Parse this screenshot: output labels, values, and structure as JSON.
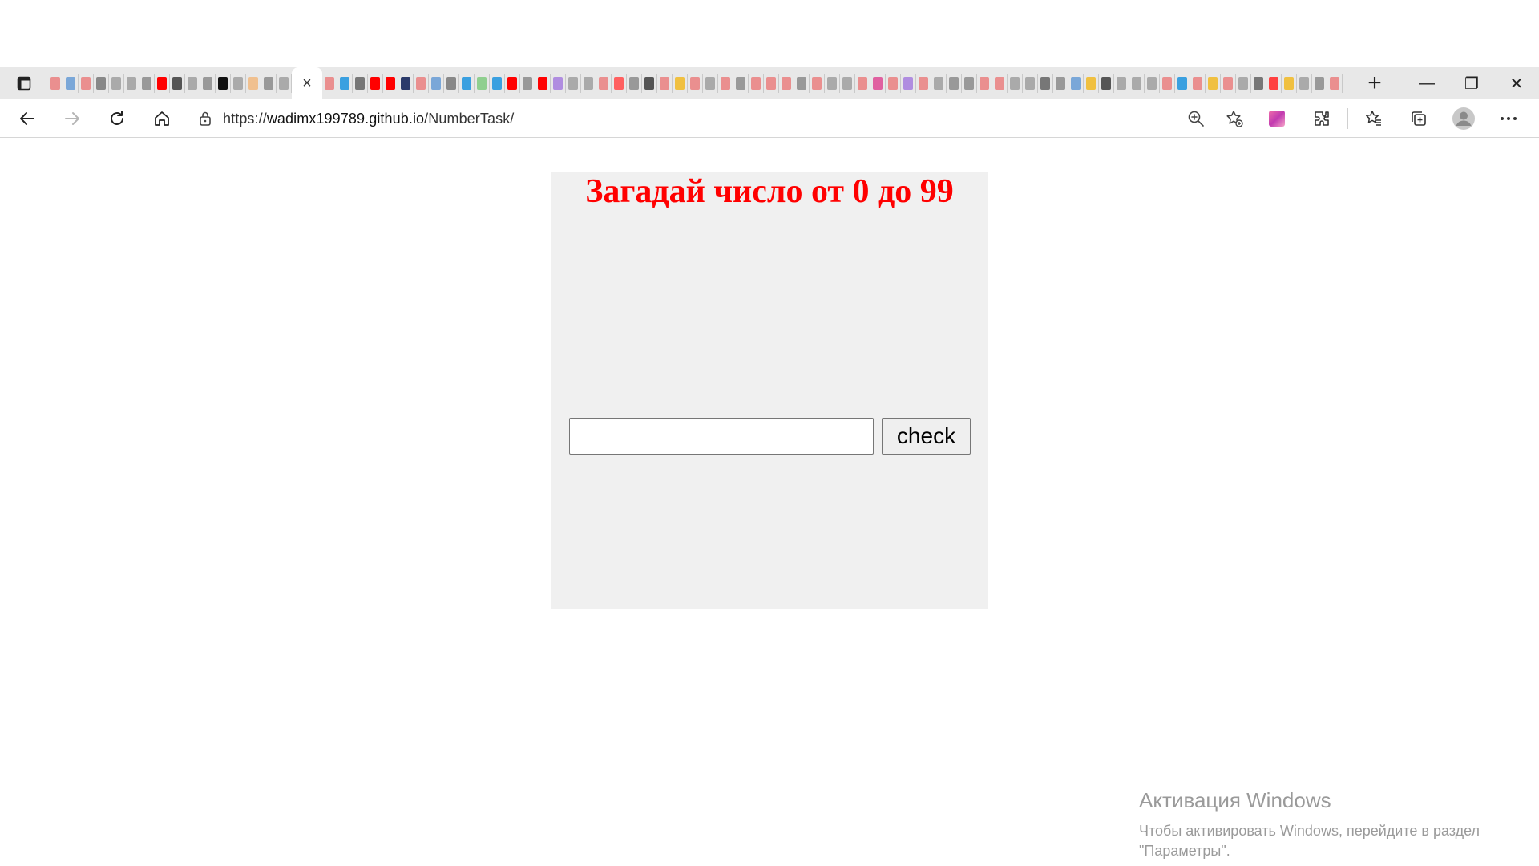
{
  "browser": {
    "tabs": {
      "favicon_colors": [
        "#ea8f8f",
        "#7aa7d8",
        "#ea8f8f",
        "#888888",
        "#aaaaaa",
        "#aaaaaa",
        "#999999",
        "#ff0000",
        "#555555",
        "#aaaaaa",
        "#999999",
        "#111111",
        "#aaaaaa",
        "#f0c08f",
        "#999999",
        "#aaaaaa",
        "#c77dd6",
        "#ea8f8f",
        "#3aa0e0",
        "#777777",
        "#ff0000",
        "#ff0000",
        "#2b3a6a",
        "#ea8f8f",
        "#7aa7d8",
        "#888888",
        "#3aa0e0",
        "#8fcf8f",
        "#3aa0e0",
        "#ff0000",
        "#999999",
        "#ff0000",
        "#b08de0",
        "#aaaaaa",
        "#aaaaaa",
        "#ea8f8f",
        "#ff6060",
        "#999999",
        "#555555",
        "#ea8f8f",
        "#f0c040",
        "#ea8f8f",
        "#aaaaaa",
        "#ea8f8f",
        "#999999",
        "#ea8f8f",
        "#ea8f8f",
        "#ea8f8f",
        "#999999",
        "#ea8f8f",
        "#aaaaaa",
        "#aaaaaa",
        "#ea8f8f",
        "#e060a0",
        "#ea8f8f",
        "#b08de0",
        "#ea8f8f",
        "#aaaaaa",
        "#999999",
        "#999999",
        "#ea8f8f",
        "#ea8f8f",
        "#aaaaaa",
        "#aaaaaa",
        "#777777",
        "#999999",
        "#7aa7d8",
        "#f0c040",
        "#555555",
        "#aaaaaa",
        "#aaaaaa",
        "#aaaaaa",
        "#ea8f8f",
        "#3aa0e0",
        "#ea8f8f",
        "#f0c040",
        "#ea8f8f",
        "#aaaaaa",
        "#777777",
        "#ff4040",
        "#f0c040",
        "#aaaaaa",
        "#999999",
        "#ea8f8f"
      ],
      "active_tab_close": "×",
      "new_tab": "+"
    },
    "window_controls": {
      "minimize": "—",
      "restore": "❐",
      "close": "✕"
    },
    "address": {
      "scheme": "https://",
      "host": "wadimx199789.github.io",
      "path": "/NumberTask/"
    },
    "toolbar_icons": [
      "back-icon",
      "forward-icon",
      "refresh-icon",
      "home-icon",
      "zoom-icon",
      "favorite-add-icon",
      "profile-color-icon",
      "extensions-icon",
      "favorites-icon",
      "collections-icon",
      "profile-avatar-icon",
      "more-icon"
    ]
  },
  "page": {
    "title": "Загадай число от 0 до 99",
    "input_value": "",
    "check_label": "check",
    "title_color": "#ff0000",
    "panel_color": "#f0f0f0"
  },
  "watermark": {
    "title": "Активация Windows",
    "text": "Чтобы активировать Windows, перейдите в раздел \"Параметры\"."
  }
}
